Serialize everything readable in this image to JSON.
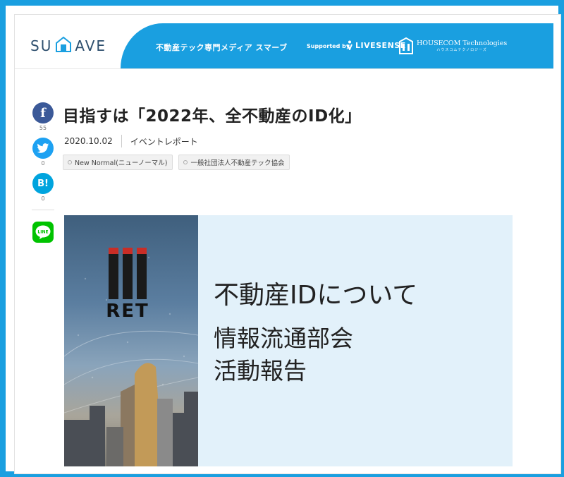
{
  "header": {
    "logo_left": "SU",
    "logo_right": "AVE",
    "tagline": "不動産テック専門メディア スマーブ",
    "supported_by": "Supported by",
    "sponsor1": "LIVESENSE",
    "sponsor2": "HOUSECOM Technologies",
    "sponsor2_sub": "ハウスコムテクノロジーズ"
  },
  "share": {
    "facebook_count": "55",
    "twitter_count": "0",
    "hatena_label": "B!",
    "hatena_count": "0",
    "line_label": "LINE"
  },
  "article": {
    "title": "目指すは「2022年、全不動産のID化」",
    "date": "2020.10.02",
    "category": "イベントレポート",
    "tags": [
      "New Normal(ニューノーマル)",
      "一般社団法人不動産テック協会"
    ]
  },
  "hero": {
    "logo_text": "RET",
    "line1": "不動産IDについて",
    "line2": "情報流通部会",
    "line3": "活動報告"
  },
  "colors": {
    "brand_blue": "#1a9fe0",
    "facebook": "#3b5998",
    "twitter": "#1da1f2",
    "hatena": "#00a4de",
    "line": "#00c300"
  }
}
